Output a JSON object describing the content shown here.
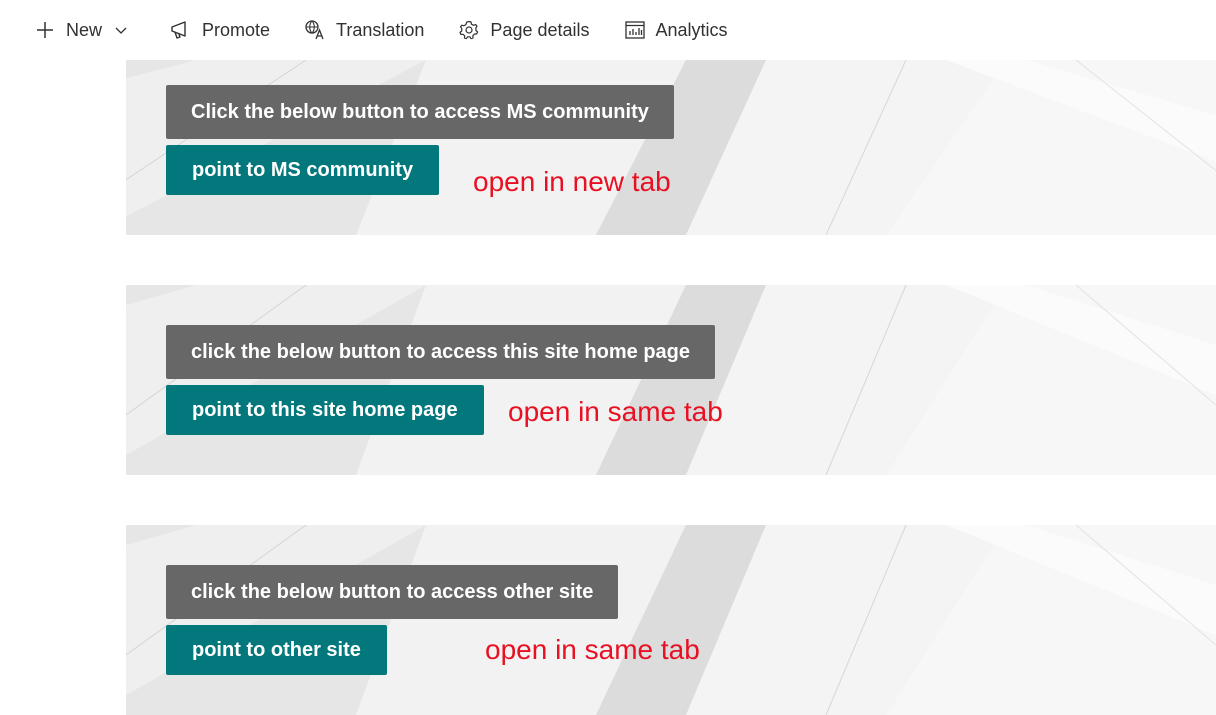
{
  "toolbar": {
    "new_label": "New",
    "promote_label": "Promote",
    "translation_label": "Translation",
    "page_details_label": "Page details",
    "analytics_label": "Analytics"
  },
  "sections": [
    {
      "heading": "Click the below button to access MS community",
      "button": "point to MS community",
      "note": "open in new tab"
    },
    {
      "heading": "click the below button to access this site home page",
      "button": "point to this site home page",
      "note": "open in same tab"
    },
    {
      "heading": "click the below button to access other site",
      "button": "point to other site",
      "note": "open in same tab"
    }
  ],
  "colors": {
    "heading_bg": "#676767",
    "button_bg": "#03787c",
    "note_text": "#e81123"
  },
  "icons": {
    "new": "plus-icon",
    "new_dropdown": "chevron-down-icon",
    "promote": "megaphone-icon",
    "translation": "translation-icon",
    "page_details": "gear-icon",
    "analytics": "chart-icon"
  }
}
